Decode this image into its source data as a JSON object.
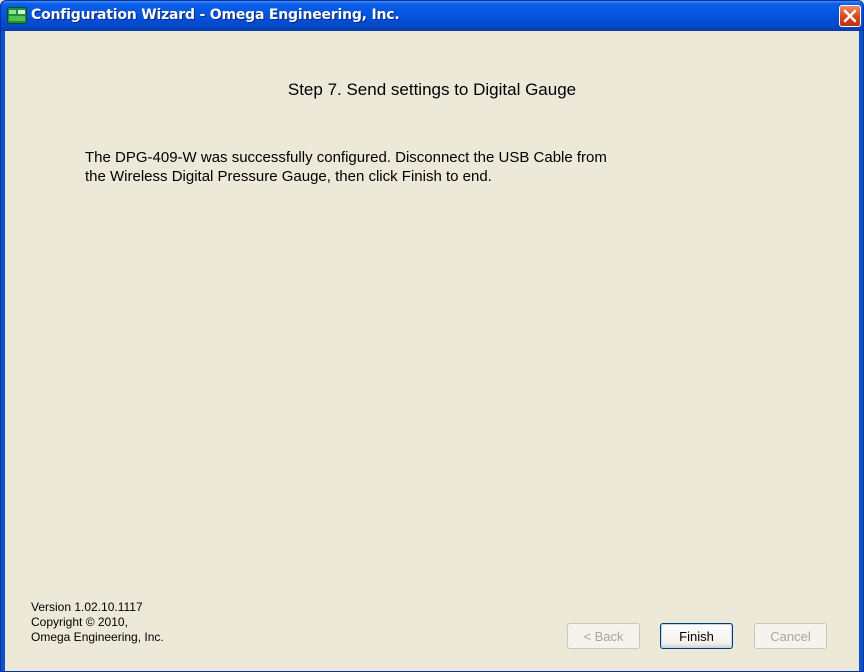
{
  "window": {
    "title": "Configuration Wizard - Omega Engineering, Inc.",
    "icon": "omega-app-icon",
    "close_icon": "close-icon"
  },
  "wizard": {
    "step_title": "Step 7.  Send settings to Digital Gauge",
    "message": "The DPG-409-W was successfully configured.  Disconnect the USB Cable from\nthe Wireless Digital Pressure Gauge, then click Finish to end."
  },
  "footer": {
    "version_info": "Version 1.02.10.1117\nCopyright © 2010,\nOmega Engineering, Inc."
  },
  "buttons": {
    "back": {
      "label": "< Back",
      "enabled": false
    },
    "finish": {
      "label": "Finish",
      "enabled": true,
      "default": true
    },
    "cancel": {
      "label": "Cancel",
      "enabled": false
    }
  }
}
